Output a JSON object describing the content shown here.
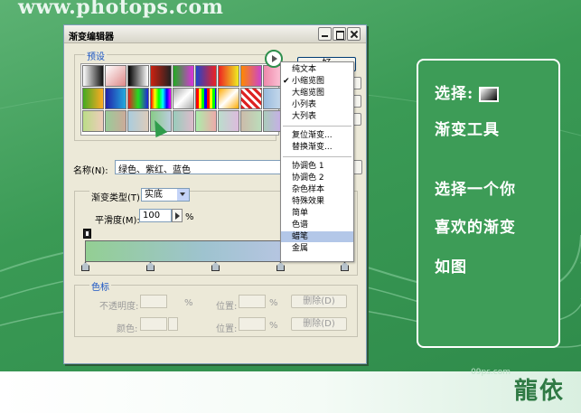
{
  "header": {
    "site_url": "www.photops.com"
  },
  "dialog": {
    "title": "渐变编辑器",
    "presets_label": "预设",
    "ok_button": "好",
    "name_label": "名称(N):",
    "name_value": "绿色、紫红、蓝色",
    "gradient_type_label": "渐变类型(T):",
    "gradient_type_value": "实底",
    "smoothness_label": "平滑度(M):",
    "smoothness_value": "100",
    "percent": "%",
    "stops_label": "色标",
    "opacity_label": "不透明度:",
    "location_label": "位置:",
    "delete_button": "删除(D)",
    "color_label": "颜色:"
  },
  "preset_swatches": [
    "linear-gradient(90deg,#fff,#111)",
    "linear-gradient(135deg,#fff,#d88)",
    "linear-gradient(90deg,#000,#fff)",
    "linear-gradient(90deg,#c21,#222)",
    "linear-gradient(90deg,#2a2,#d3d)",
    "linear-gradient(90deg,#24c,#e22)",
    "linear-gradient(90deg,#e22,#ee2)",
    "linear-gradient(90deg,#f80,#c4c)",
    "linear-gradient(90deg,#e8a,#fcd)",
    "linear-gradient(90deg,#4a2,#fa2)",
    "linear-gradient(90deg,#22a,#2ad)",
    "linear-gradient(90deg,#d22,#2d2,#22d)",
    "linear-gradient(90deg,#f00,#ff0,#0f0,#0ff,#00f,#f0f)",
    "linear-gradient(135deg,#aaa,#fff,#aaa)",
    "repeating-linear-gradient(90deg,#f00 0 3px,#ff0 3px 6px,#0f0 6px 9px,#00f 9px 12px)",
    "linear-gradient(135deg,#fa0,#fff,#fa0)",
    "repeating-linear-gradient(45deg,#d22 0 3px,#fff 3px 6px)",
    "linear-gradient(90deg,#9bd,#cde)",
    "linear-gradient(90deg,#bd8,#ecb)",
    "linear-gradient(90deg,#9c9,#ca9)",
    "linear-gradient(90deg,#acd,#dcb)",
    "linear-gradient(90deg,#8c8,#bcd)",
    "linear-gradient(90deg,#9cb,#dbc)",
    "linear-gradient(90deg,#aea,#eaa)",
    "linear-gradient(90deg,#bdc,#dbd)",
    "linear-gradient(90deg,#cba,#bdb)",
    "linear-gradient(90deg,#acb,#cae)"
  ],
  "preset_menu": {
    "items": [
      {
        "label": "纯文本",
        "checked": false,
        "selected": false
      },
      {
        "label": "小缩览图",
        "checked": true,
        "selected": false
      },
      {
        "label": "大缩览图",
        "checked": false,
        "selected": false
      },
      {
        "label": "小列表",
        "checked": false,
        "selected": false
      },
      {
        "label": "大列表",
        "checked": false,
        "selected": false
      },
      {
        "label": "复位渐变...",
        "checked": false,
        "selected": false
      },
      {
        "label": "替换渐变...",
        "checked": false,
        "selected": false
      },
      {
        "label": "协调色 1",
        "checked": false,
        "selected": false
      },
      {
        "label": "协调色 2",
        "checked": false,
        "selected": false
      },
      {
        "label": "杂色样本",
        "checked": false,
        "selected": false
      },
      {
        "label": "特殊效果",
        "checked": false,
        "selected": false
      },
      {
        "label": "简单",
        "checked": false,
        "selected": false
      },
      {
        "label": "色谱",
        "checked": false,
        "selected": false
      },
      {
        "label": "蜡笔",
        "checked": false,
        "selected": true
      },
      {
        "label": "金属",
        "checked": false,
        "selected": false
      }
    ],
    "check_mark": "✔"
  },
  "info_panel": {
    "line1": "选择:",
    "line2": "渐变工具",
    "line3": "选择一个你",
    "line4": "喜欢的渐变",
    "line5": "如图"
  },
  "footer": {
    "watermark_small": "09ps.com",
    "signature": "龍依"
  }
}
